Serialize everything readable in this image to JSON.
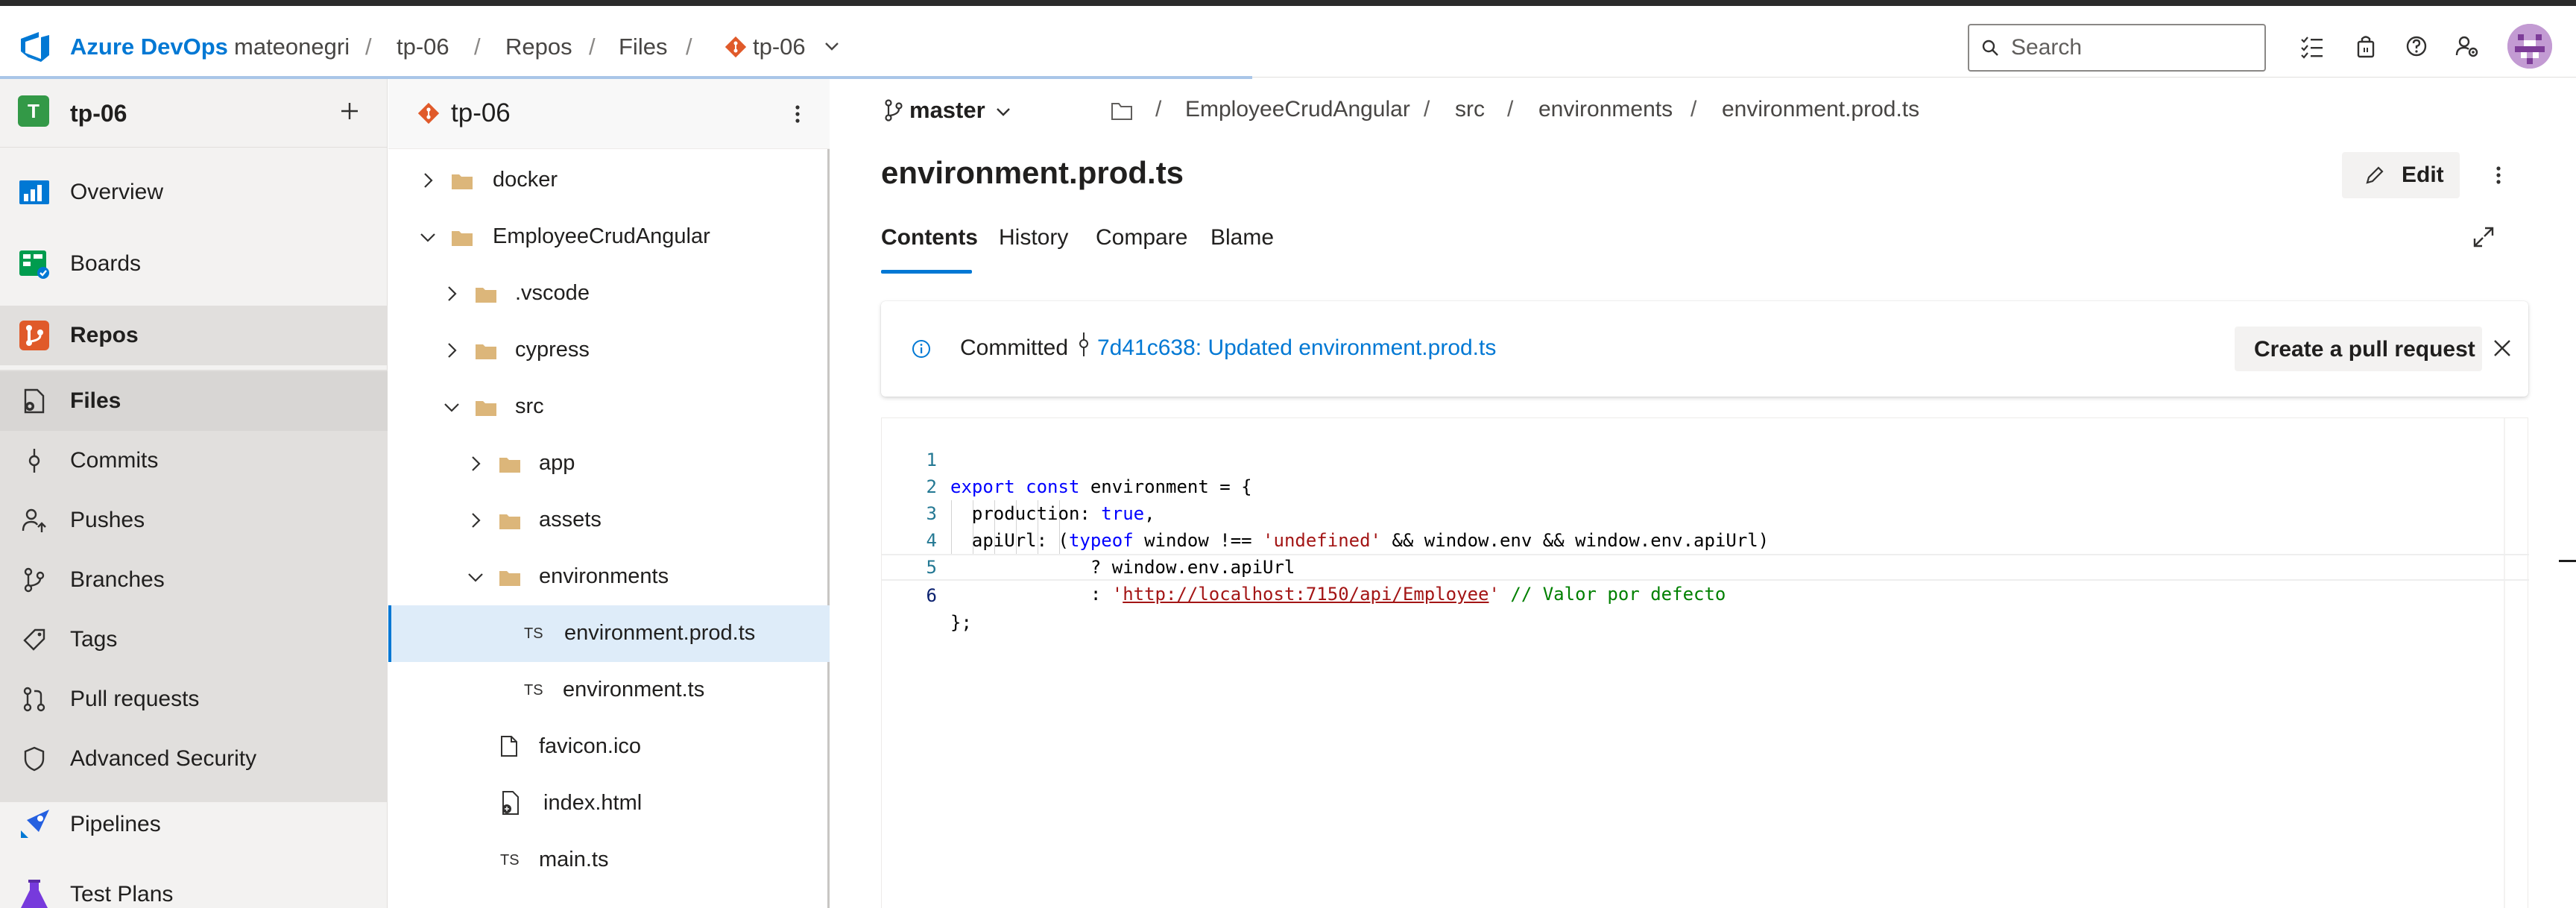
{
  "app": {
    "brand": "Azure DevOps",
    "breadcrumbs": [
      "mateonegri",
      "tp-06",
      "Repos",
      "Files",
      "tp-06"
    ],
    "search_placeholder": "Search"
  },
  "sidebar": {
    "project_initial": "T",
    "project_name": "tp-06",
    "items": [
      {
        "label": "Overview"
      },
      {
        "label": "Boards"
      },
      {
        "label": "Repos"
      },
      {
        "label": "Files"
      },
      {
        "label": "Commits"
      },
      {
        "label": "Pushes"
      },
      {
        "label": "Branches"
      },
      {
        "label": "Tags"
      },
      {
        "label": "Pull requests"
      },
      {
        "label": "Advanced Security"
      },
      {
        "label": "Pipelines"
      },
      {
        "label": "Test Plans"
      }
    ]
  },
  "tree": {
    "repo_name": "tp-06",
    "rows": [
      {
        "label": "docker",
        "kind": "folder",
        "expanded": false
      },
      {
        "label": "EmployeeCrudAngular",
        "kind": "folder",
        "expanded": true
      },
      {
        "label": ".vscode",
        "kind": "folder",
        "expanded": false
      },
      {
        "label": "cypress",
        "kind": "folder",
        "expanded": false
      },
      {
        "label": "src",
        "kind": "folder",
        "expanded": true
      },
      {
        "label": "app",
        "kind": "folder",
        "expanded": false
      },
      {
        "label": "assets",
        "kind": "folder",
        "expanded": false
      },
      {
        "label": "environments",
        "kind": "folder",
        "expanded": true
      },
      {
        "label": "environment.prod.ts",
        "kind": "ts",
        "badge": "TS",
        "selected": true
      },
      {
        "label": "environment.ts",
        "kind": "ts",
        "badge": "TS"
      },
      {
        "label": "favicon.ico",
        "kind": "file"
      },
      {
        "label": "index.html",
        "kind": "html"
      },
      {
        "label": "main.ts",
        "kind": "ts",
        "badge": "TS"
      }
    ]
  },
  "main": {
    "branch": "master",
    "path": [
      "EmployeeCrudAngular",
      "src",
      "environments",
      "environment.prod.ts"
    ],
    "file_title": "environment.prod.ts",
    "edit_label": "Edit",
    "tabs": [
      "Contents",
      "History",
      "Compare",
      "Blame"
    ],
    "active_tab": "Contents",
    "banner": {
      "committed_label": "Committed",
      "commit_link": "7d41c638: Updated environment.prod.ts",
      "pr_button": "Create a pull request"
    },
    "code": {
      "line_numbers": [
        "1",
        "2",
        "3",
        "4",
        "5",
        "6"
      ],
      "l1": {
        "kw1": "export",
        "kw2": "const",
        "rest": " environment = {"
      },
      "l2": {
        "a": "  production: ",
        "kw": "true",
        "b": ","
      },
      "l3": {
        "a": "  apiUrl: (",
        "kw": "typeof",
        "b": " window !== ",
        "str": "'undefined'",
        "c": " && window.env && window.env.apiUrl)"
      },
      "l4": {
        "a": "             ? window.env.apiUrl"
      },
      "l5": {
        "a": "             : ",
        "q1": "'",
        "url": "http://localhost:7150/api/Employee",
        "q2": "'",
        "cmt": " // Valor por defecto"
      },
      "l6": {
        "a": "};"
      }
    }
  },
  "colors": {
    "accent": "#0078d4",
    "project_badge": "#339947",
    "folder": "#dcb67a",
    "git_orange": "#e05a2a"
  }
}
